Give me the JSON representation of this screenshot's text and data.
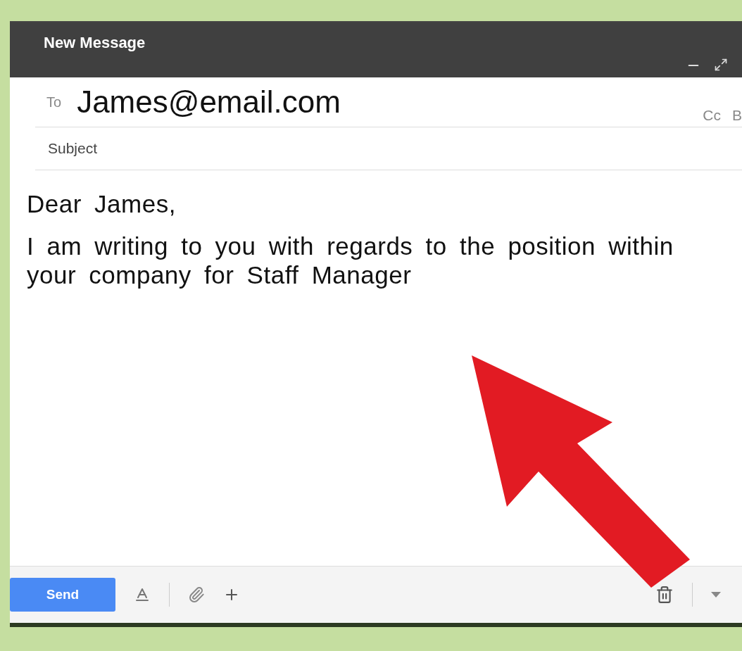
{
  "window": {
    "title": "New Message"
  },
  "to": {
    "label": "To",
    "value": "James@email.com"
  },
  "recipients_links": [
    "Cc",
    "B"
  ],
  "subject": {
    "placeholder": "Subject"
  },
  "body": [
    "Dear James,",
    "I am writing to you with regards to the position within your company for Staff Manager"
  ],
  "toolbar": {
    "send": "Send"
  }
}
